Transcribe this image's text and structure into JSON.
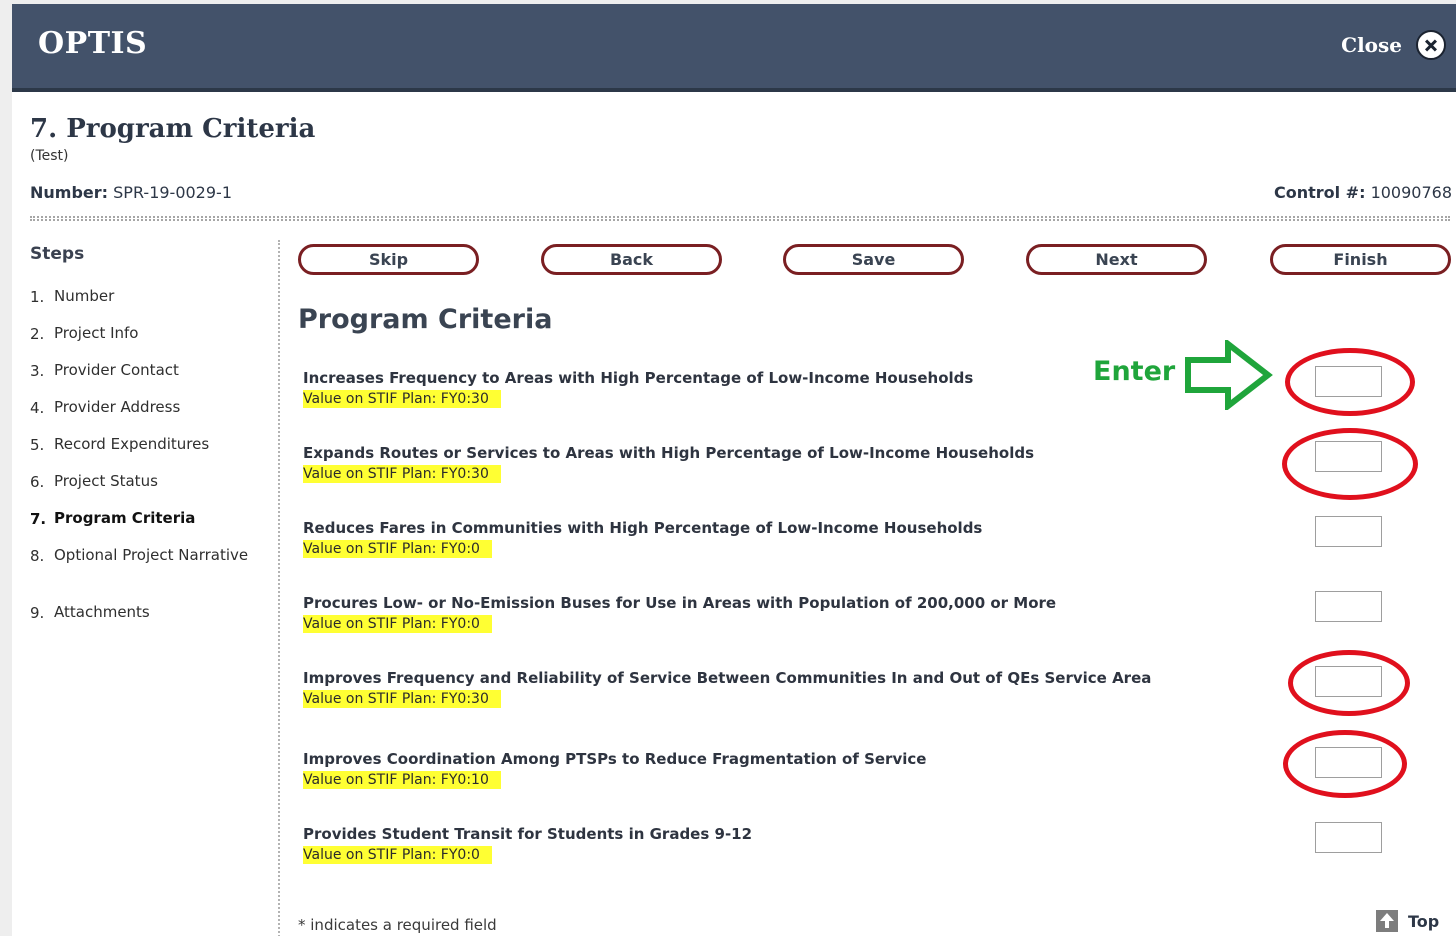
{
  "header": {
    "app_title": "OPTIS",
    "close_label": "Close"
  },
  "page": {
    "title": "7. Program Criteria",
    "subtitle": "(Test)",
    "number_label": "Number:",
    "number_value": "SPR-19-0029-1",
    "control_label": "Control #:",
    "control_value": "10090768"
  },
  "steps": {
    "heading": "Steps",
    "items": [
      {
        "num": "1.",
        "label": "Number"
      },
      {
        "num": "2.",
        "label": "Project Info"
      },
      {
        "num": "3.",
        "label": "Provider Contact"
      },
      {
        "num": "4.",
        "label": "Provider Address"
      },
      {
        "num": "5.",
        "label": "Record Expenditures"
      },
      {
        "num": "6.",
        "label": "Project Status"
      },
      {
        "num": "7.",
        "label": "Program Criteria"
      },
      {
        "num": "8.",
        "label": "Optional Project Narrative"
      },
      {
        "num": "9.",
        "label": "Attachments"
      }
    ]
  },
  "buttons": {
    "skip": "Skip",
    "back": "Back",
    "save": "Save",
    "next": "Next",
    "finish": "Finish"
  },
  "section_title": "Program Criteria",
  "criteria": [
    {
      "label": "Increases Frequency to Areas with High Percentage of Low-Income Households",
      "value": "Value on STIF Plan: FY0:30",
      "input_value": "",
      "highlighted": true
    },
    {
      "label": "Expands Routes or Services to Areas with High Percentage of Low-Income Households",
      "value": "Value on STIF Plan: FY0:30",
      "input_value": "",
      "highlighted": true
    },
    {
      "label": "Reduces Fares in Communities with High Percentage of Low-Income Households",
      "value": "Value on STIF Plan: FY0:0",
      "input_value": "",
      "highlighted": false
    },
    {
      "label": "Procures Low- or No-Emission Buses for Use in Areas with Population of 200,000 or More",
      "value": "Value on STIF Plan: FY0:0",
      "input_value": "",
      "highlighted": false
    },
    {
      "label": "Improves Frequency and Reliability of Service Between Communities In and Out of QEs Service Area",
      "value": "Value on STIF Plan: FY0:30",
      "input_value": "",
      "highlighted": true
    },
    {
      "label": "Improves Coordination Among PTSPs to Reduce Fragmentation of Service",
      "value": "Value on STIF Plan: FY0:10",
      "input_value": "",
      "highlighted": true
    },
    {
      "label": "Provides Student Transit for Students in Grades 9-12",
      "value": "Value on STIF Plan: FY0:0",
      "input_value": "",
      "highlighted": false
    }
  ],
  "annotation": {
    "enter_label": "Enter",
    "arrow_color": "#1fa53b",
    "ring_color": "#e0101d"
  },
  "footer": {
    "required_note": "* indicates a required field",
    "top_label": "Top"
  },
  "colors": {
    "header_bg": "#43526a",
    "button_border": "#7a1f22",
    "value_highlight": "#ffff33"
  }
}
